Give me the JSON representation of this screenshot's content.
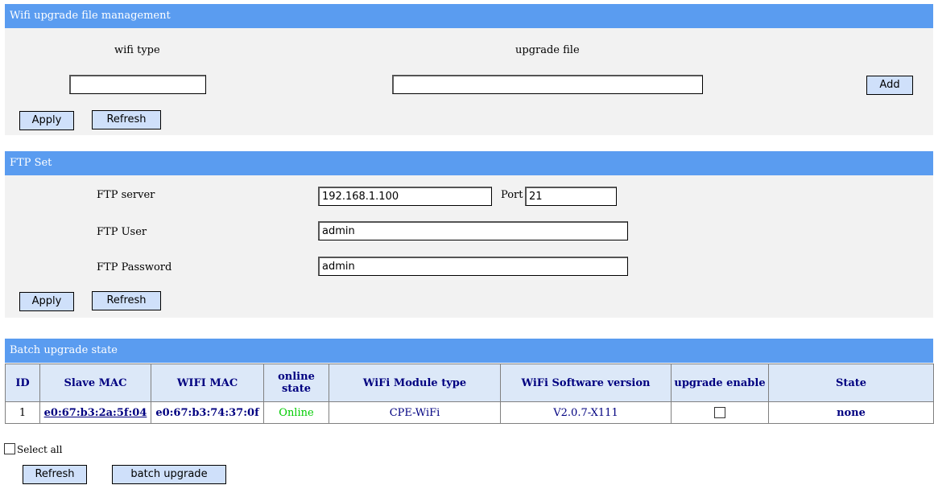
{
  "wifi_upgrade": {
    "title": "Wifi upgrade file management",
    "col_wifi_type": "wifi type",
    "col_upgrade_file": "upgrade file",
    "wifi_type_value": "",
    "upgrade_file_value": "",
    "add_label": "Add",
    "apply_label": "Apply",
    "refresh_label": "Refresh"
  },
  "ftp": {
    "title": "FTP Set",
    "server_label": "FTP server",
    "server_value": "192.168.1.100",
    "port_label": "Port",
    "port_value": "21",
    "user_label": "FTP User",
    "user_value": "admin",
    "password_label": "FTP Password",
    "password_value": "admin",
    "apply_label": "Apply",
    "refresh_label": "Refresh"
  },
  "batch": {
    "title": "Batch upgrade state",
    "headers": [
      "ID",
      "Slave MAC",
      "WIFI MAC",
      "online state",
      "WiFi Module type",
      "WiFi Software version",
      "upgrade enable",
      "State"
    ],
    "rows": [
      {
        "id": "1",
        "slave_mac": "e0:67:b3:2a:5f:04",
        "wifi_mac": "e0:67:b3:74:37:0f",
        "online_state": "Online",
        "module_type": "CPE-WiFi",
        "software_version": "V2.0.7-X111",
        "upgrade_enable": false,
        "state": "none"
      }
    ],
    "select_all_label": "Select all",
    "refresh_label": "Refresh",
    "batch_upgrade_label": "batch upgrade"
  },
  "colors": {
    "header_bar": "#5a9cf0",
    "panel_bg": "#f2f2f2",
    "button_bg": "#cfe0fa",
    "online_green": "#00cc00",
    "table_header_text": "#000080"
  }
}
